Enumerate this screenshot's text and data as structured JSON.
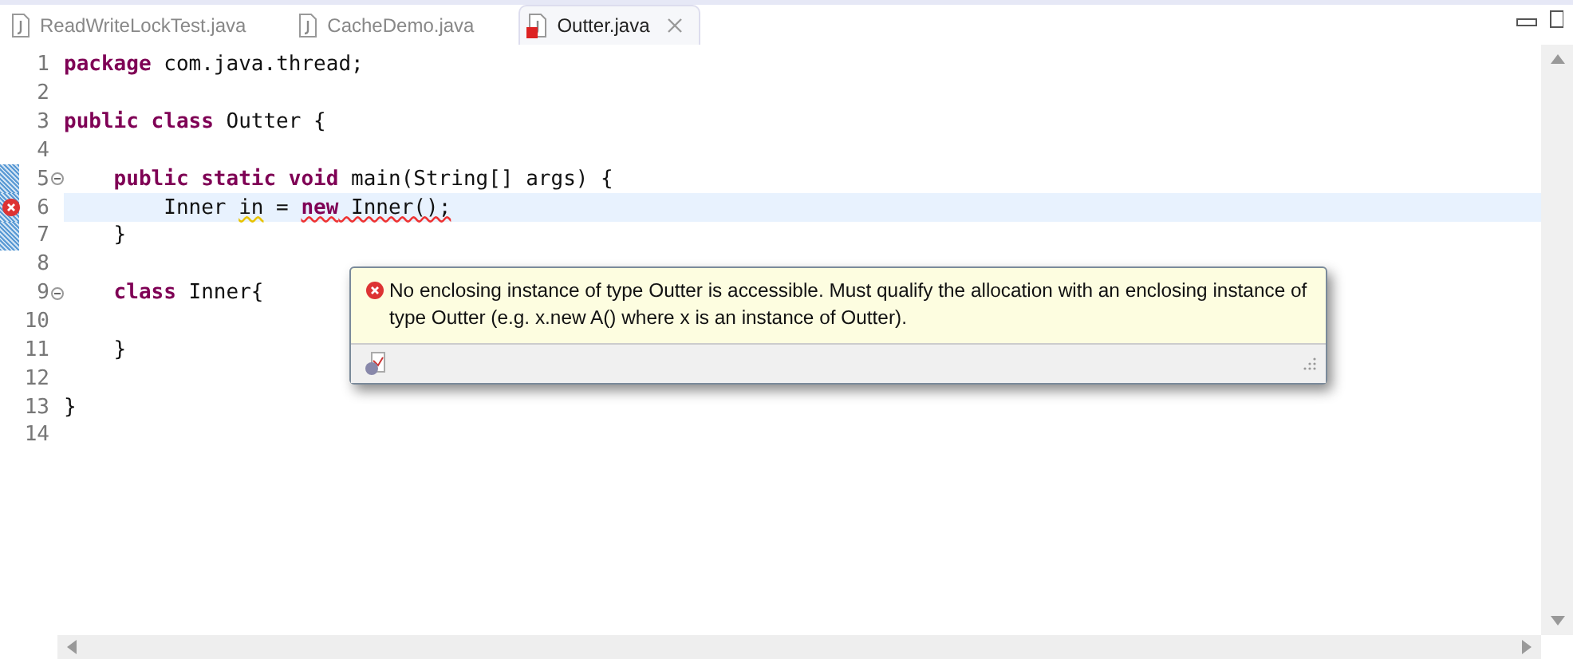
{
  "tabs": [
    {
      "label": "ReadWriteLockTest.java",
      "selected": false,
      "error": false
    },
    {
      "label": "CacheDemo.java",
      "selected": false,
      "error": false
    },
    {
      "label": "Outter.java",
      "selected": true,
      "error": true
    }
  ],
  "editor": {
    "lines": [
      {
        "number": "1",
        "foldable": false,
        "error": false,
        "current": false,
        "range_marked": false,
        "tokens": [
          {
            "text": "package",
            "kind": "keyword"
          },
          {
            "text": " com.java.thread;",
            "kind": "text"
          }
        ]
      },
      {
        "number": "2",
        "foldable": false,
        "error": false,
        "current": false,
        "range_marked": false
      },
      {
        "number": "3",
        "foldable": false,
        "error": false,
        "current": false,
        "range_marked": false,
        "tokens": [
          {
            "text": "public class",
            "kind": "keyword"
          },
          {
            "text": " Outter {",
            "kind": "text"
          }
        ]
      },
      {
        "number": "4",
        "foldable": false,
        "error": false,
        "current": false,
        "range_marked": false
      },
      {
        "number": "5",
        "foldable": true,
        "error": false,
        "current": false,
        "range_marked": true,
        "tokens": [
          {
            "text": "    public static void",
            "kind": "keyword"
          },
          {
            "text": " main(String[] args) {",
            "kind": "text"
          }
        ]
      },
      {
        "number": "6",
        "foldable": false,
        "error": true,
        "current": true,
        "range_marked": true,
        "tokens": [
          {
            "text": "        Inner ",
            "kind": "text",
            "error_underline": false,
            "warning_underline": false
          },
          {
            "text": "in",
            "kind": "text",
            "error_underline": false,
            "warning_underline": true
          },
          {
            "text": " = ",
            "kind": "text",
            "error_underline": false,
            "warning_underline": false
          },
          {
            "text": "new",
            "kind": "keyword",
            "error_underline": true,
            "warning_underline": false
          },
          {
            "text": " Inner();",
            "kind": "text",
            "error_underline": true,
            "warning_underline": false
          }
        ]
      },
      {
        "number": "7",
        "foldable": false,
        "error": false,
        "current": false,
        "range_marked": true,
        "tokens": [
          {
            "text": "    }",
            "kind": "text"
          }
        ]
      },
      {
        "number": "8",
        "foldable": false,
        "error": false,
        "current": false,
        "range_marked": false
      },
      {
        "number": "9",
        "foldable": true,
        "error": false,
        "current": false,
        "range_marked": false,
        "tokens": [
          {
            "text": "    class",
            "kind": "keyword"
          },
          {
            "text": " Inner{",
            "kind": "text"
          }
        ]
      },
      {
        "number": "10",
        "foldable": false,
        "error": false,
        "current": false,
        "range_marked": false
      },
      {
        "number": "11",
        "foldable": false,
        "error": false,
        "current": false,
        "range_marked": false,
        "tokens": [
          {
            "text": "    }",
            "kind": "text"
          }
        ]
      },
      {
        "number": "12",
        "foldable": false,
        "error": false,
        "current": false,
        "range_marked": false
      },
      {
        "number": "13",
        "foldable": false,
        "error": false,
        "current": false,
        "range_marked": false,
        "tokens": [
          {
            "text": "}",
            "kind": "text"
          }
        ]
      },
      {
        "number": "14",
        "foldable": false,
        "error": false,
        "current": false,
        "range_marked": false
      }
    ]
  },
  "hover_popup": {
    "message": "No enclosing instance of type Outter is accessible. Must qualify the allocation with an enclosing instance of type Outter (e.g. x.new A() where x is an instance of Outter)."
  }
}
